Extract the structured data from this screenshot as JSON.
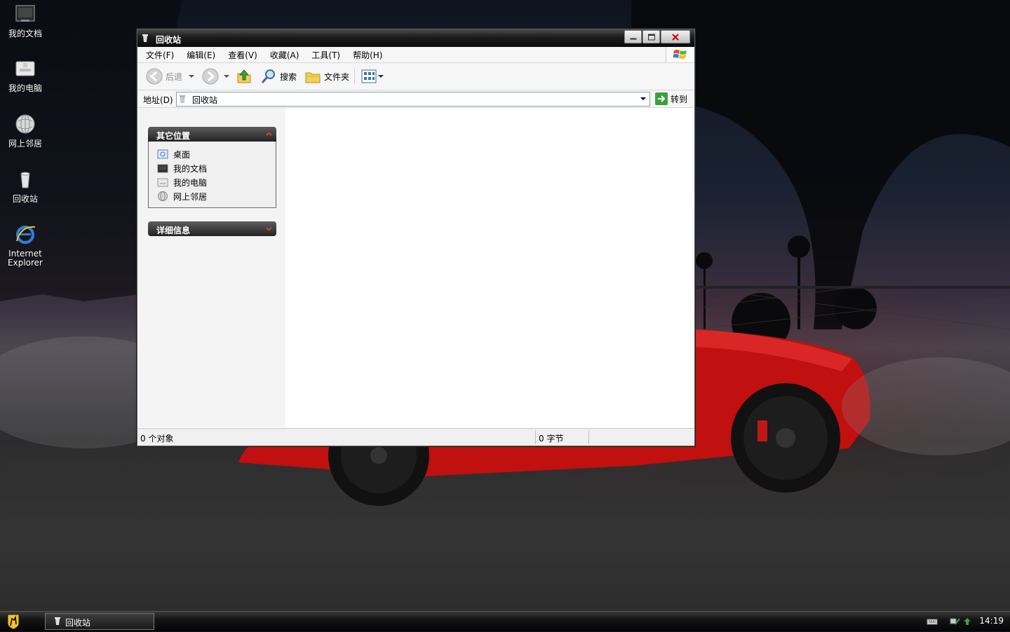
{
  "desktop": {
    "icons": [
      {
        "label": "我的文档",
        "icon": "my-documents-icon"
      },
      {
        "label": "我的电脑",
        "icon": "my-computer-icon"
      },
      {
        "label": "网上邻居",
        "icon": "network-places-icon"
      },
      {
        "label": "回收站",
        "icon": "recycle-bin-icon"
      },
      {
        "label": "Internet",
        "label2": "Explorer",
        "icon": "internet-explorer-icon"
      }
    ]
  },
  "window": {
    "title": "回收站",
    "menu": [
      "文件(F)",
      "编辑(E)",
      "查看(V)",
      "收藏(A)",
      "工具(T)",
      "帮助(H)"
    ],
    "toolbar": {
      "back": "后退",
      "search": "搜索",
      "folders": "文件夹"
    },
    "address": {
      "label": "地址(D)",
      "value": "回收站",
      "go": "转到"
    },
    "panels": {
      "other_places": {
        "title": "其它位置",
        "items": [
          {
            "label": "桌面",
            "icon": "desktop-icon"
          },
          {
            "label": "我的文档",
            "icon": "my-documents-icon"
          },
          {
            "label": "我的电脑",
            "icon": "my-computer-icon"
          },
          {
            "label": "网上邻居",
            "icon": "network-places-icon"
          }
        ]
      },
      "details": {
        "title": "详细信息"
      }
    },
    "status": {
      "objects": "0 个对象",
      "size": "0 字节"
    }
  },
  "taskbar": {
    "task_label": "回收站",
    "clock": "14:19"
  },
  "colors": {
    "titlebar": "#1c1c1c",
    "car_red": "#c81414",
    "panel_head": "#2e2e2e"
  }
}
